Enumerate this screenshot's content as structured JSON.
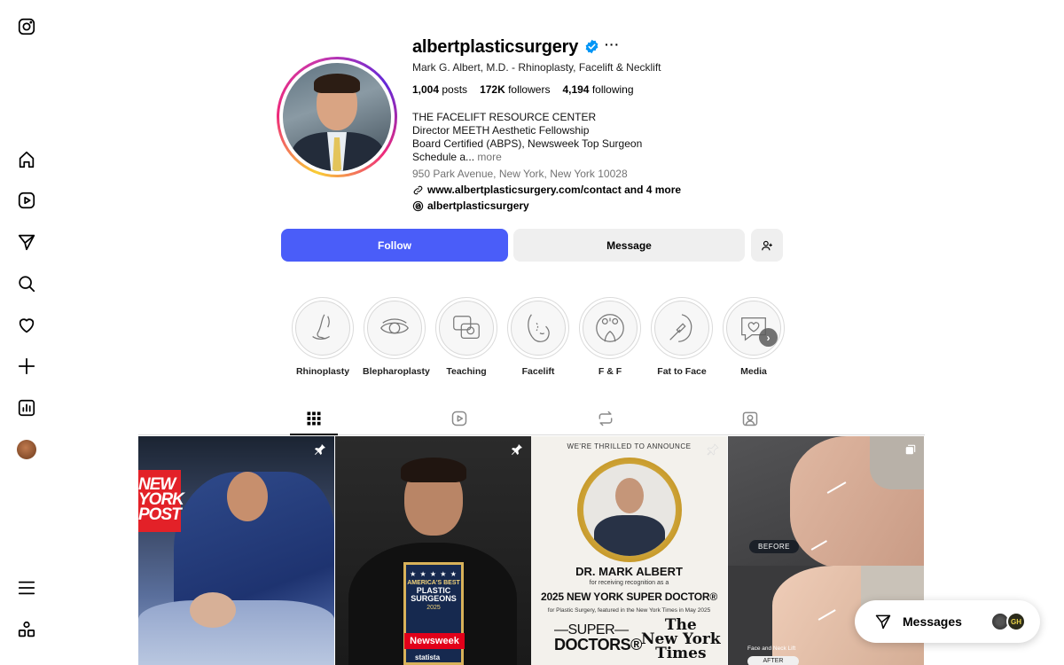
{
  "profile": {
    "username": "albertplasticsurgery",
    "more_dots": "···",
    "full_name": "Mark G. Albert, M.D. - Rhinoplasty, Facelift & Necklift",
    "stats": {
      "posts_count": "1,004",
      "posts_label": "posts",
      "followers_count": "172K",
      "followers_label": "followers",
      "following_count": "4,194",
      "following_label": "following"
    },
    "bio": {
      "line1": "THE FACELIFT RESOURCE CENTER",
      "line2": "Director MEETH Aesthetic Fellowship",
      "line3": "Board Certified (ABPS), Newsweek Top Surgeon",
      "line4": "Schedule a...",
      "more": "more"
    },
    "address": "950 Park Avenue, New York, New York 10028",
    "link": "www.albertplasticsurgery.com/contact and 4 more",
    "threads": "albertplasticsurgery"
  },
  "actions": {
    "follow": "Follow",
    "message": "Message"
  },
  "highlights": [
    {
      "label": "Rhinoplasty",
      "icon": "nose-icon"
    },
    {
      "label": "Blepharoplasty",
      "icon": "eye-icon"
    },
    {
      "label": "Teaching",
      "icon": "chat-icon"
    },
    {
      "label": "Facelift",
      "icon": "face-icon"
    },
    {
      "label": "F & F",
      "icon": "faces-icon"
    },
    {
      "label": "Fat to Face",
      "icon": "syringe-icon"
    },
    {
      "label": "Media",
      "icon": "message-heart-icon"
    }
  ],
  "tabs": [
    "posts-grid-icon",
    "reels-icon",
    "reposts-icon",
    "tagged-icon"
  ],
  "posts": {
    "p1": {
      "tag": "NEW YORK POST"
    },
    "p2": {
      "stars": "★ ★ ★ ★ ★",
      "line1": "AMERICA'S BEST",
      "line2": "PLASTIC",
      "line3": "SURGEONS",
      "year": "2025",
      "brand": "Newsweek",
      "statista": "statista"
    },
    "p3": {
      "announce": "WE'RE THRILLED TO ANNOUNCE",
      "name": "DR. MARK ALBERT",
      "recognition": "for receiving recognition as a",
      "title": "2025 NEW YORK SUPER DOCTOR®",
      "detail": "for Plastic Surgery, featured in the New York Times in May 2025",
      "sd_line1": "—SUPER—",
      "sd_line2": "DOCTORS®",
      "nyt_line1": "The",
      "nyt_line2": "New York",
      "nyt_line3": "Times"
    },
    "p4": {
      "before": "BEFORE",
      "caption": "Face and Neck Lift",
      "after": "AFTER"
    }
  },
  "messages": {
    "label": "Messages",
    "avatar2_initials": "GH"
  },
  "colors": {
    "follow_button": "#4a5df9",
    "verified_badge": "#0095f6"
  }
}
